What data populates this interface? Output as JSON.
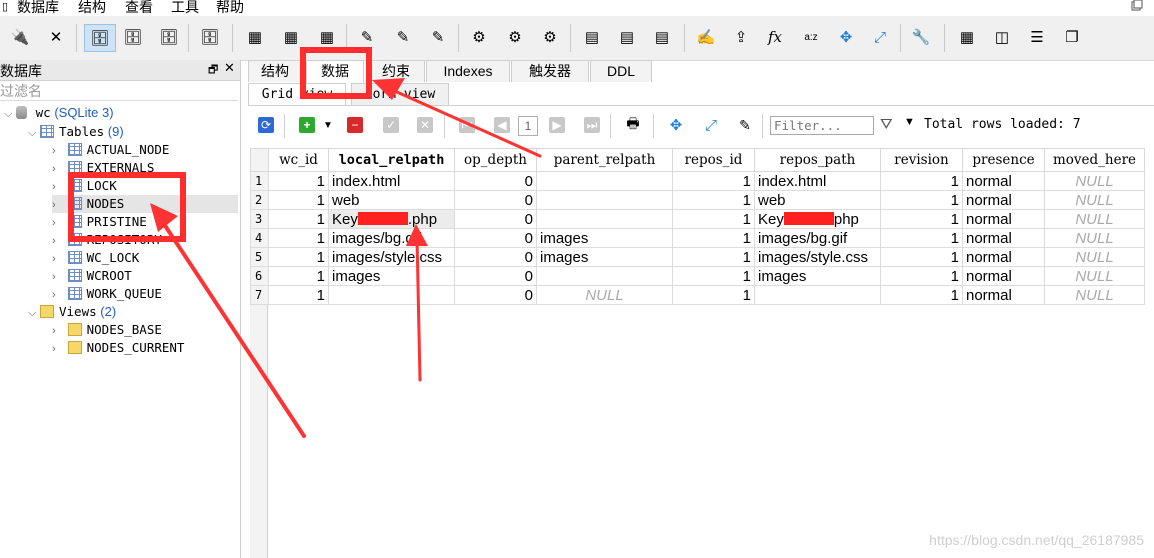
{
  "menu": {
    "items": [
      "数据库",
      "结构",
      "查看",
      "工具",
      "帮助"
    ]
  },
  "toolbar": {
    "icons": [
      "plug-icon",
      "unplug-icon",
      "add-database-icon",
      "edit-database-icon",
      "remove-database-icon",
      "refresh-database-icon",
      "new-table-icon",
      "edit-table-icon",
      "drop-table-icon",
      "new-index-icon",
      "edit-index-icon",
      "drop-index-icon",
      "new-trigger-icon",
      "edit-trigger-icon",
      "drop-trigger-icon",
      "new-view-icon",
      "edit-view-icon",
      "drop-view-icon",
      "sql-editor-icon",
      "export-icon",
      "function-icon",
      "collation-icon",
      "extension-icon",
      "fullscreen-icon",
      "settings-icon",
      "layout-1-icon",
      "layout-2-icon",
      "layout-3-icon",
      "layout-4-icon"
    ]
  },
  "left_panel": {
    "title": "数据库",
    "filter_placeholder": "过滤名",
    "db_name": "wc",
    "db_type": "(SQLite 3)",
    "tables_label": "Tables",
    "tables_count": "(9)",
    "tables": [
      "ACTUAL_NODE",
      "EXTERNALS",
      "LOCK",
      "NODES",
      "PRISTINE",
      "REPOSITORY",
      "WC_LOCK",
      "WCROOT",
      "WORK_QUEUE"
    ],
    "views_label": "Views",
    "views_count": "(2)",
    "views": [
      "NODES_BASE",
      "NODES_CURRENT"
    ]
  },
  "tabs": [
    "结构",
    "数据",
    "约束",
    "Indexes",
    "触发器",
    "DDL"
  ],
  "active_tab": "数据",
  "subtabs": [
    "Grid view",
    "Form view"
  ],
  "grid_toolbar": {
    "page": "1",
    "filter_placeholder": "Filter...",
    "total_rows_text": "Total rows loaded: 7"
  },
  "grid": {
    "columns": [
      "wc_id",
      "local_relpath",
      "op_depth",
      "parent_relpath",
      "repos_id",
      "repos_path",
      "revision",
      "presence",
      "moved_here"
    ],
    "rows": [
      [
        "1",
        "1",
        "index.html",
        "0",
        "",
        "1",
        "index.html",
        "1",
        "normal",
        "NULL"
      ],
      [
        "2",
        "1",
        "web",
        "0",
        "",
        "1",
        "web",
        "1",
        "normal",
        "NULL"
      ],
      [
        "3",
        "1",
        "Key[redacted].php",
        "0",
        "",
        "1",
        "Key[redacted]php",
        "1",
        "normal",
        "NULL"
      ],
      [
        "4",
        "1",
        "images/bg.gif",
        "0",
        "images",
        "1",
        "images/bg.gif",
        "1",
        "normal",
        "NULL"
      ],
      [
        "5",
        "1",
        "images/style.css",
        "0",
        "images",
        "1",
        "images/style.css",
        "1",
        "normal",
        "NULL"
      ],
      [
        "6",
        "1",
        "images",
        "0",
        "",
        "1",
        "images",
        "1",
        "normal",
        "NULL"
      ],
      [
        "7",
        "1",
        "",
        "0",
        "NULL",
        "1",
        "",
        "1",
        "normal",
        "NULL"
      ]
    ]
  },
  "watermark": "https://blog.csdn.net/qq_26187985",
  "colors": {
    "highlight": "#ff2d2d",
    "count_blue": "#1f5fbf",
    "null_gray": "#a9a9a9"
  }
}
